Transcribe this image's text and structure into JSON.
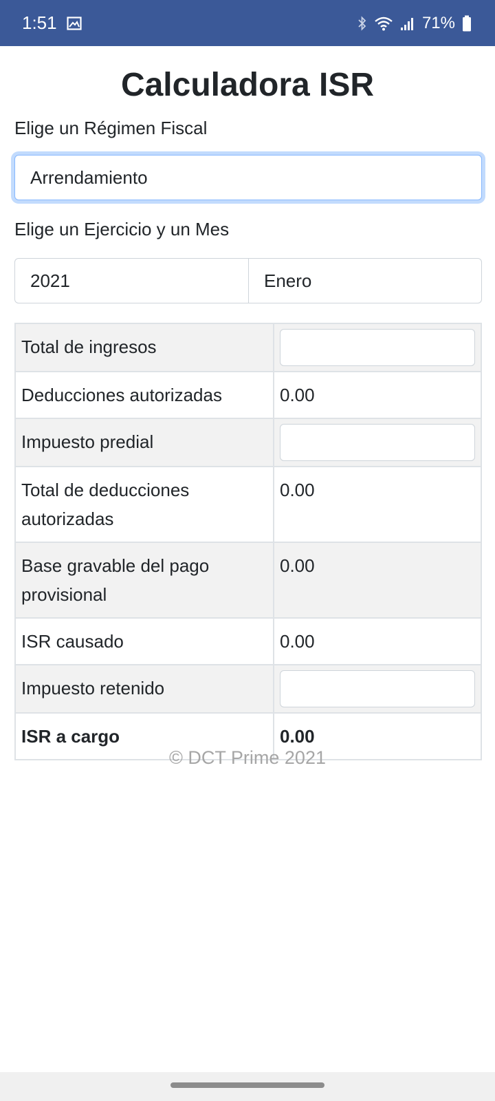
{
  "status_bar": {
    "time": "1:51",
    "battery": "71%"
  },
  "page": {
    "title": "Calculadora ISR"
  },
  "regime": {
    "label": "Elige un Régimen Fiscal",
    "selected": "Arrendamiento"
  },
  "period": {
    "label": "Elige un Ejercicio y un Mes",
    "year": "2021",
    "month": "Enero"
  },
  "table": {
    "rows": [
      {
        "label": "Total de ingresos",
        "type": "input",
        "value": "",
        "shaded": true
      },
      {
        "label": "Deducciones autorizadas",
        "type": "value",
        "value": "0.00",
        "shaded": false
      },
      {
        "label": "Impuesto predial",
        "type": "input",
        "value": "",
        "shaded": true
      },
      {
        "label": "Total de deducciones autorizadas",
        "type": "value",
        "value": "0.00",
        "shaded": false
      },
      {
        "label": "Base gravable del pago provisional",
        "type": "value",
        "value": "0.00",
        "shaded": true
      },
      {
        "label": "ISR causado",
        "type": "value",
        "value": "0.00",
        "shaded": false
      },
      {
        "label": "Impuesto retenido",
        "type": "input",
        "value": "",
        "shaded": true
      },
      {
        "label": "ISR a cargo",
        "type": "value",
        "value": "0.00",
        "shaded": false,
        "bold": true
      }
    ]
  },
  "footer": {
    "text": "© DCT Prime 2021"
  },
  "colors": {
    "status_bar": "#3b5998",
    "focus_ring": "#c2dbfd",
    "row_shade": "#f2f2f2"
  },
  "icons": [
    "image-icon",
    "bluetooth-icon",
    "wifi-icon",
    "signal-icon",
    "battery-icon"
  ]
}
